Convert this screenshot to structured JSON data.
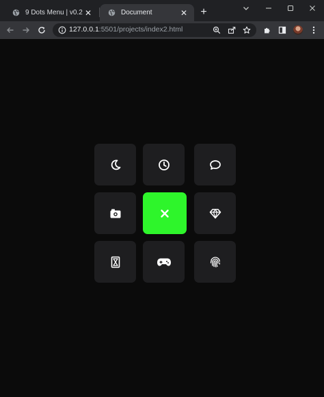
{
  "tabs": [
    {
      "title": "9 Dots Menu | v0.2",
      "active": false
    },
    {
      "title": "Document",
      "active": true
    }
  ],
  "address_bar": {
    "host": "127.0.0.1",
    "path": ":5501/projects/index2.html"
  },
  "menu_items": [
    {
      "icon": "moon-icon"
    },
    {
      "icon": "clock-icon"
    },
    {
      "icon": "chat-bubble-icon"
    },
    {
      "icon": "camera-icon"
    },
    {
      "icon": "close-icon"
    },
    {
      "icon": "diamond-icon"
    },
    {
      "icon": "hourglass-icon"
    },
    {
      "icon": "gamepad-icon"
    },
    {
      "icon": "fingerprint-icon"
    }
  ],
  "colors": {
    "page_background": "#0b0b0b",
    "tile": "#1e1e20",
    "accent": "#2ef52b",
    "icon": "#ffffff"
  }
}
